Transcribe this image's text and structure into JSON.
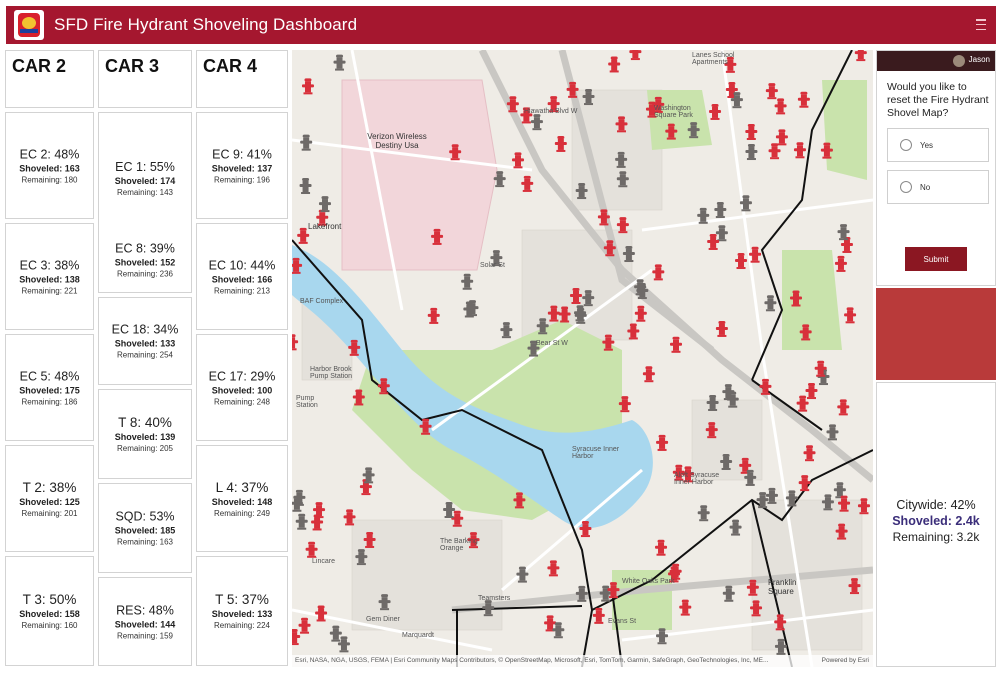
{
  "header": {
    "title": "SFD Fire Hydrant Shoveling Dashboard"
  },
  "columns": [
    {
      "title": "CAR 2",
      "cards": [
        {
          "name": "EC 2: 48%",
          "shoveled": "Shoveled: 163",
          "remaining": "Remaining: 180"
        },
        {
          "name": "EC 3: 38%",
          "shoveled": "Shoveled: 138",
          "remaining": "Remaining: 221"
        },
        {
          "name": "EC 5: 48%",
          "shoveled": "Shoveled: 175",
          "remaining": "Remaining: 186"
        },
        {
          "name": "T 2: 38%",
          "shoveled": "Shoveled: 125",
          "remaining": "Remaining: 201"
        },
        {
          "name": "T 3: 50%",
          "shoveled": "Shoveled: 158",
          "remaining": "Remaining: 160"
        }
      ]
    },
    {
      "title": "CAR 3",
      "cards": [
        {
          "name": "EC 1: 55%",
          "shoveled": "Shoveled: 174",
          "remaining": "Remaining: 143"
        },
        {
          "name": "EC 8: 39%",
          "shoveled": "Shoveled: 152",
          "remaining": "Remaining: 236"
        },
        {
          "name": "EC 18: 34%",
          "shoveled": "Shoveled: 133",
          "remaining": "Remaining: 254"
        },
        {
          "name": "T 8: 40%",
          "shoveled": "Shoveled: 139",
          "remaining": "Remaining: 205"
        },
        {
          "name": "SQD: 53%",
          "shoveled": "Shoveled: 185",
          "remaining": "Remaining: 163"
        },
        {
          "name": "RES: 48%",
          "shoveled": "Shoveled: 144",
          "remaining": "Remaining: 159"
        }
      ]
    },
    {
      "title": "CAR 4",
      "cards": [
        {
          "name": "EC 9: 41%",
          "shoveled": "Shoveled: 137",
          "remaining": "Remaining: 196"
        },
        {
          "name": "EC 10: 44%",
          "shoveled": "Shoveled: 166",
          "remaining": "Remaining: 213"
        },
        {
          "name": "EC 17: 29%",
          "shoveled": "Shoveled: 100",
          "remaining": "Remaining: 248"
        },
        {
          "name": "L 4: 37%",
          "shoveled": "Shoveled: 148",
          "remaining": "Remaining: 249"
        },
        {
          "name": "T 5: 37%",
          "shoveled": "Shoveled: 133",
          "remaining": "Remaining: 224"
        }
      ]
    }
  ],
  "map": {
    "labels": {
      "verizon": "Verizon Wireless Destiny Usa",
      "lakefront": "Lakefront",
      "baf": "BAF Complex",
      "harbor_brook": "Harbor Brook Pump Station",
      "pump": "Pump Station",
      "syracuse_harbor": "Syracuse Inner Harbor",
      "aloft": "Aloft Syracuse Inner Harbor",
      "washington_sq": "Washington Square Park",
      "franklin_sq": "Franklin Square",
      "white_oaks": "White Oaks Park",
      "gem_diner": "Gem Diner",
      "barking_orange": "The Barking Orange",
      "lincare": "Lincare",
      "marquardt": "Marquardt",
      "teamsters": "Teamsters",
      "evans": "Evans St",
      "solar": "Solar St",
      "bear": "Bear St W",
      "hiawatha": "Hiawatha Blvd W",
      "schools": "Lanes School Apartments"
    },
    "attribution": "Esri, NASA, NGA, USGS, FEMA | Esri Community Maps Contributors, © OpenStreetMap, Microsoft, Esri, TomTom, Garmin, SafeGraph, GeoTechnologies, Inc, ME...",
    "powered_by": "Powered by Esri"
  },
  "survey": {
    "user": "Jason",
    "question": "Would you like to reset the Fire Hydrant Shovel Map?",
    "options": [
      "Yes",
      "No"
    ],
    "submit_label": "Submit"
  },
  "citywide": {
    "percent": "Citywide: 42%",
    "shoveled": "Shoveled: 2.4k",
    "remaining": "Remaining: 3.2k"
  },
  "colors": {
    "header": "#a5172f",
    "hydrant_unshoveled": "#d8303b",
    "hydrant_shoveled": "#6e6a68",
    "water": "#a8d7ee",
    "park": "#c9e3ac",
    "accent_panel": "#b93a3a",
    "submit": "#8b1722"
  }
}
